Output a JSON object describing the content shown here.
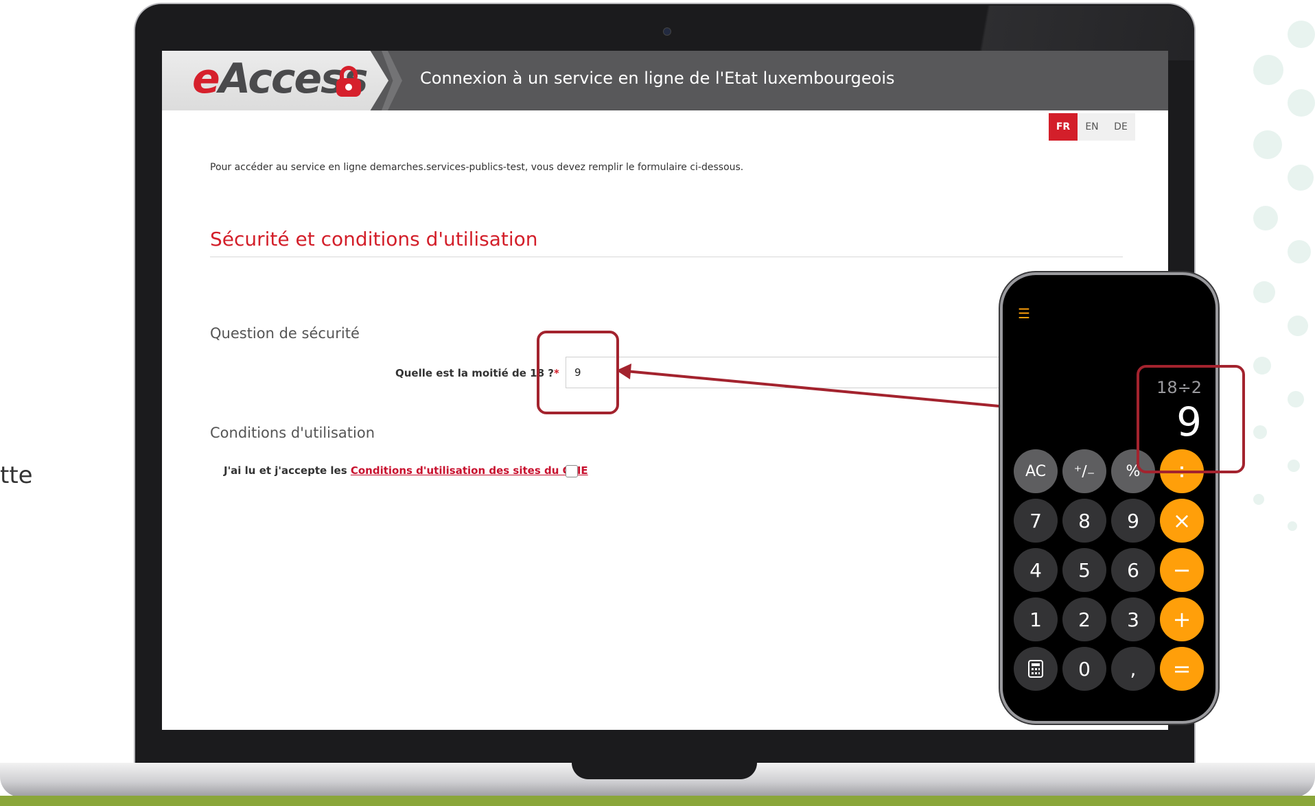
{
  "side_text": "tte",
  "header": {
    "logo_e": "e",
    "logo_rest": "Access",
    "title": "Connexion à un service en ligne de l'Etat luxembourgeois"
  },
  "languages": [
    {
      "label": "FR",
      "active": true
    },
    {
      "label": "EN",
      "active": false
    },
    {
      "label": "DE",
      "active": false
    }
  ],
  "intro": "Pour accéder au service en ligne demarches.services-publics-test, vous devez remplir le formulaire ci-dessous.",
  "section_title": "Sécurité et conditions d'utilisation",
  "security": {
    "heading": "Question de sécurité",
    "question": "Quelle est la moitié de 18 ?",
    "required_mark": "*",
    "answer": "9"
  },
  "terms": {
    "heading": "Conditions d'utilisation",
    "prefix": "J'ai lu et j'accepte les ",
    "link": "Conditions d'utilisation des sites du CTIE",
    "checked": false
  },
  "calculator": {
    "expression": "18÷2",
    "result": "9",
    "keys": [
      "AC",
      "⁺∕₋",
      "%",
      "÷",
      "7",
      "8",
      "9",
      "×",
      "4",
      "5",
      "6",
      "−",
      "1",
      "2",
      "3",
      "+",
      "calculator-icon",
      "0",
      ",",
      "="
    ]
  },
  "colors": {
    "brand_red": "#d31f2a",
    "header_gray": "#58585a",
    "annotation_red": "#a3232e",
    "calc_orange": "#ff9f0a"
  }
}
